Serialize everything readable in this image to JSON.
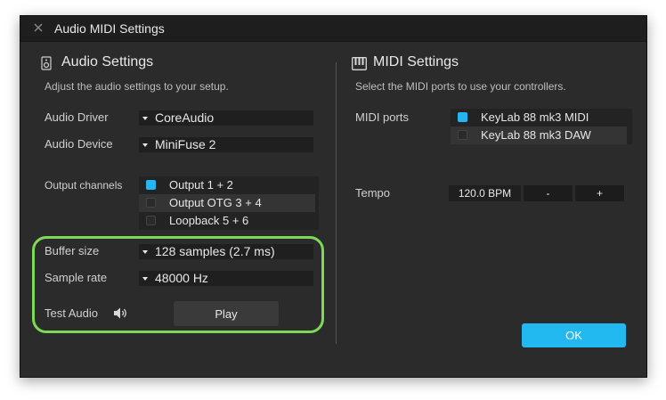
{
  "window": {
    "title": "Audio MIDI Settings"
  },
  "audio": {
    "title": "Audio Settings",
    "subtitle": "Adjust the audio settings to your setup.",
    "driver": {
      "label": "Audio Driver",
      "value": "CoreAudio"
    },
    "device": {
      "label": "Audio Device",
      "value": "MiniFuse 2"
    },
    "output": {
      "label": "Output channels",
      "channels": [
        {
          "name": "Output 1 + 2",
          "checked": true
        },
        {
          "name": "Output OTG 3 + 4",
          "checked": false
        },
        {
          "name": "Loopback 5 + 6",
          "checked": false
        }
      ]
    },
    "buffer": {
      "label": "Buffer size",
      "value": "128 samples (2.7 ms)"
    },
    "samplerate": {
      "label": "Sample rate",
      "value": "48000 Hz"
    },
    "test": {
      "label": "Test Audio",
      "button": "Play"
    }
  },
  "midi": {
    "title": "MIDI Settings",
    "subtitle": "Select the MIDI ports to use your controllers.",
    "ports": {
      "label": "MIDI ports",
      "items": [
        {
          "name": "KeyLab 88 mk3 MIDI",
          "checked": true
        },
        {
          "name": "KeyLab 88 mk3 DAW",
          "checked": false
        }
      ]
    },
    "tempo": {
      "label": "Tempo",
      "value": "120.0 BPM",
      "minus": "-",
      "plus": "+"
    },
    "ok": "OK"
  },
  "colors": {
    "accent": "#27b5f2",
    "highlight": "#7ed957",
    "panel": "#2b2b2b"
  }
}
